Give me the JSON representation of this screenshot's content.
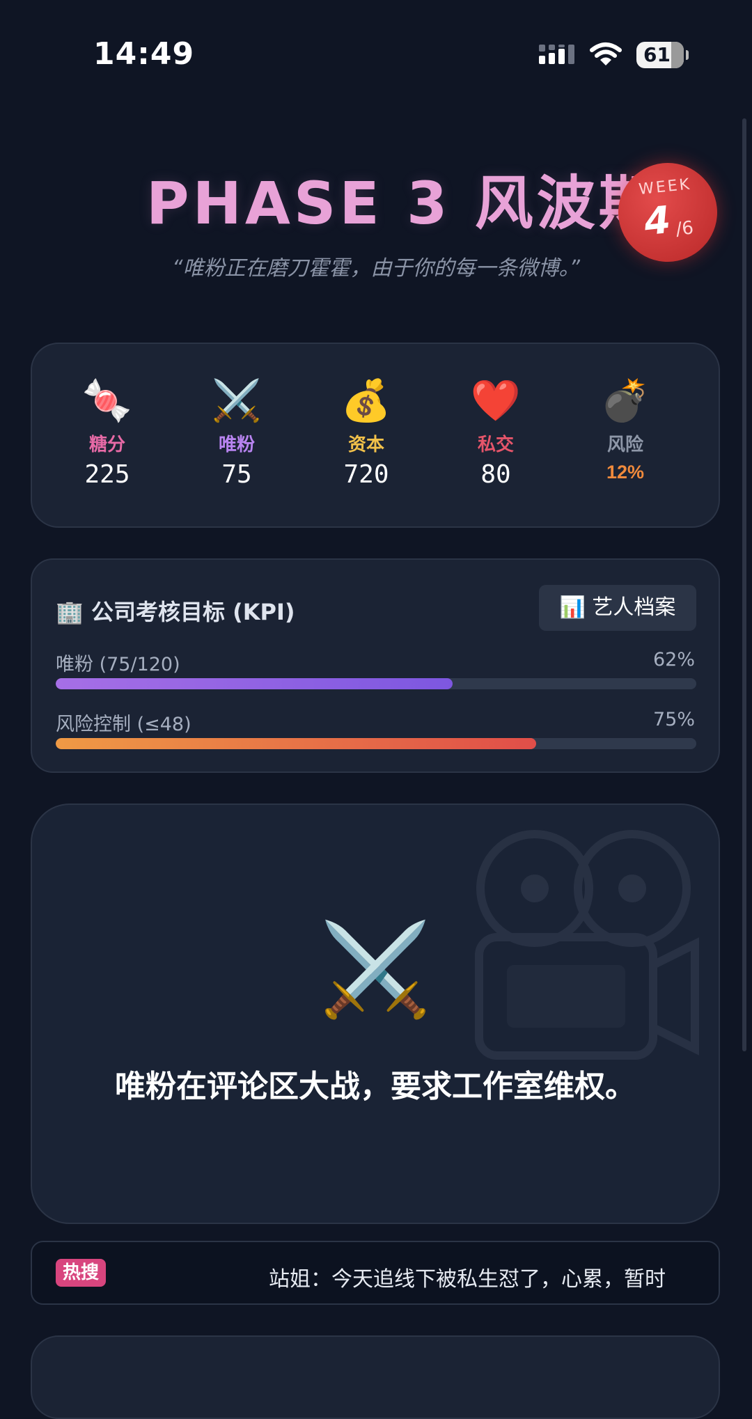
{
  "status_bar": {
    "time": "14:49",
    "battery": "61"
  },
  "header": {
    "title": "PHASE 3 风波期",
    "subtitle": "“唯粉正在磨刀霍霍，由于你的每一条微博。”",
    "week_label": "WEEK",
    "week_current": "4",
    "week_total": "/6"
  },
  "stats": [
    {
      "icon": "candy-icon",
      "glyph": "🍬",
      "label": "糖分",
      "value": "225",
      "color": "#e76aa6"
    },
    {
      "icon": "crossed-swords-icon",
      "glyph": "⚔️",
      "label": "唯粉",
      "value": "75",
      "color": "#b884f0"
    },
    {
      "icon": "money-bag-icon",
      "glyph": "💰",
      "label": "资本",
      "value": "720",
      "color": "#f2c14a"
    },
    {
      "icon": "heart-icon",
      "glyph": "❤️",
      "label": "私交",
      "value": "80",
      "color": "#e6556a"
    },
    {
      "icon": "bomb-icon",
      "glyph": "💣",
      "label": "风险",
      "value": "12%",
      "color": "#8e97a8",
      "value_color": "#f08a3c"
    }
  ],
  "kpi": {
    "title": "🏢 公司考核目标 (KPI)",
    "profile_button": "📊 艺人档案",
    "rows": [
      {
        "label": "唯粉 (75/120)",
        "percent_label": "62%",
        "progress": 0.62
      },
      {
        "label": "风险控制 (≤48)",
        "percent_label": "75%",
        "progress": 0.75
      }
    ]
  },
  "event": {
    "icon": "crossed-swords-icon",
    "glyph": "⚔️",
    "text": "唯粉在评论区大战，要求工作室维权。"
  },
  "hot_search": {
    "tag": "热搜",
    "text": "站姐：今天追线下被私生怼了，心累，暂时"
  }
}
